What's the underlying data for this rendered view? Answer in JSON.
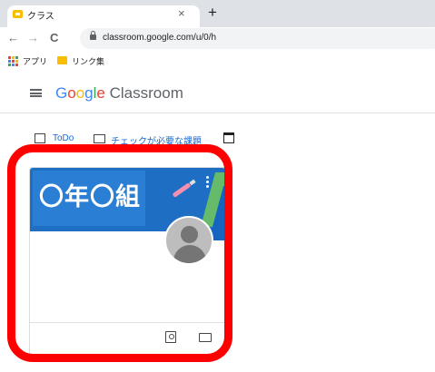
{
  "browser": {
    "tab_title": "クラス",
    "tab_close": "×",
    "new_tab": "+",
    "back": "←",
    "forward": "→",
    "reload": "C",
    "url": "classroom.google.com/u/0/h"
  },
  "bookmarks": [
    {
      "label": "アプリ",
      "icon": "apps-grid-icon"
    },
    {
      "label": "リンク集",
      "icon": "folder-icon"
    }
  ],
  "app": {
    "brand_google": [
      "G",
      "o",
      "o",
      "g",
      "l",
      "e"
    ],
    "brand_colors": [
      "#4285f4",
      "#ea4335",
      "#fbbc04",
      "#4285f4",
      "#34a853",
      "#ea4335"
    ],
    "brand_product": " Classroom"
  },
  "toolbar": {
    "todo_label": "ToDo",
    "review_label": "チェックが必要な課題",
    "calendar_icon": "calendar-icon"
  },
  "class_card": {
    "title": "〇年〇組",
    "banner_color": "#1e6fc4",
    "footer_icons": [
      "portfolio-icon",
      "folder-icon"
    ]
  },
  "annotation": {
    "highlight_color": "#ff0000"
  }
}
